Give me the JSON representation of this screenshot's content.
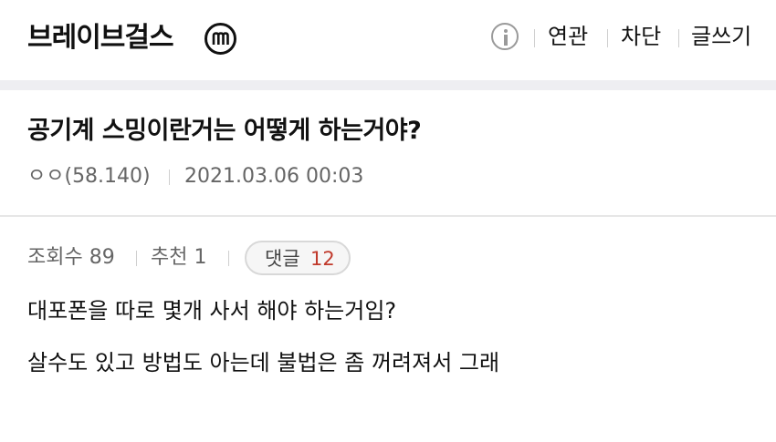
{
  "header": {
    "gallery_title": "브레이브걸스",
    "badge_letter": "m",
    "links": [
      "연관",
      "차단",
      "글쓰기"
    ]
  },
  "post": {
    "title": "공기계 스밍이란거는 어떻게 하는거야?",
    "author": "ㅇㅇ(58.140)",
    "datetime": "2021.03.06 00:03",
    "views": "조회수 89",
    "recommend": "추천 1",
    "comment_label": "댓글",
    "comment_count": "12",
    "body": [
      "대포폰을 따로 몇개 사서 해야 하는거임?",
      "살수도 있고 방법도 아는데 불법은 좀 꺼려져서 그래"
    ]
  },
  "colors": {
    "accent_red": "#c0392b",
    "divider": "#eeeef2",
    "muted_text": "#666666"
  }
}
